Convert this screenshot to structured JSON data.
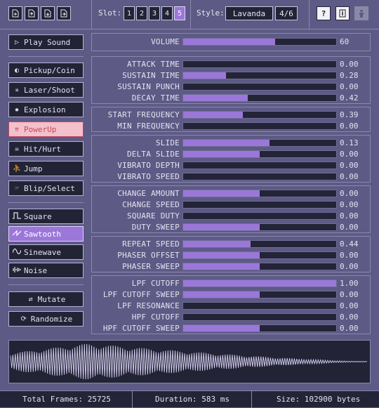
{
  "toolbar": {
    "slot_label": "Slot:",
    "slots": [
      "1",
      "2",
      "3",
      "4",
      "5"
    ],
    "active_slot": "5",
    "style_label": "Style:",
    "style_value": "Lavanda",
    "style_counter": "4/6"
  },
  "generators": [
    {
      "label": "Play Sound",
      "icon": "play-icon"
    },
    {
      "label": "Pickup/Coin",
      "icon": "coin-icon"
    },
    {
      "label": "Laser/Shoot",
      "icon": "laser-icon"
    },
    {
      "label": "Explosion",
      "icon": "explosion-icon"
    },
    {
      "label": "PowerUp",
      "icon": "powerup-icon"
    },
    {
      "label": "Hit/Hurt",
      "icon": "skull-icon"
    },
    {
      "label": "Jump",
      "icon": "jump-icon"
    },
    {
      "label": "Blip/Select",
      "icon": "blip-icon"
    }
  ],
  "waveforms": [
    {
      "label": "Square",
      "icon": "square-wave-icon"
    },
    {
      "label": "Sawtooth",
      "icon": "sawtooth-wave-icon"
    },
    {
      "label": "Sinewave",
      "icon": "sine-wave-icon"
    },
    {
      "label": "Noise",
      "icon": "noise-wave-icon"
    }
  ],
  "actions": [
    {
      "label": "Mutate",
      "icon": "mutate-icon"
    },
    {
      "label": "Randomize",
      "icon": "randomize-icon"
    }
  ],
  "volume": {
    "label": "VOLUME",
    "value": "60",
    "fraction": 0.6
  },
  "params": [
    {
      "label": "ATTACK TIME",
      "value": "0.00",
      "fraction": 0.0
    },
    {
      "label": "SUSTAIN TIME",
      "value": "0.28",
      "fraction": 0.28
    },
    {
      "label": "SUSTAIN PUNCH",
      "value": "0.00",
      "fraction": 0.0
    },
    {
      "label": "DECAY TIME",
      "value": "0.42",
      "fraction": 0.42
    },
    {
      "label": "START FREQUENCY",
      "value": "0.39",
      "fraction": 0.39
    },
    {
      "label": "MIN FREQUENCY",
      "value": "0.00",
      "fraction": 0.0
    },
    {
      "label": "SLIDE",
      "value": "0.13",
      "fraction": 0.565
    },
    {
      "label": "DELTA SLIDE",
      "value": "0.00",
      "fraction": 0.5
    },
    {
      "label": "VIBRATO DEPTH",
      "value": "0.00",
      "fraction": 0.0
    },
    {
      "label": "VIBRATO SPEED",
      "value": "0.00",
      "fraction": 0.0
    },
    {
      "label": "CHANGE AMOUNT",
      "value": "0.00",
      "fraction": 0.5
    },
    {
      "label": "CHANGE SPEED",
      "value": "0.00",
      "fraction": 0.0
    },
    {
      "label": "SQUARE DUTY",
      "value": "0.00",
      "fraction": 0.0
    },
    {
      "label": "DUTY SWEEP",
      "value": "0.00",
      "fraction": 0.5
    },
    {
      "label": "REPEAT SPEED",
      "value": "0.44",
      "fraction": 0.44
    },
    {
      "label": "PHASER OFFSET",
      "value": "0.00",
      "fraction": 0.5
    },
    {
      "label": "PHASER SWEEP",
      "value": "0.00",
      "fraction": 0.5
    },
    {
      "label": "LPF CUTOFF",
      "value": "1.00",
      "fraction": 1.0
    },
    {
      "label": "LPF CUTOFF SWEEP",
      "value": "0.00",
      "fraction": 0.5
    },
    {
      "label": "LPF RESONANCE",
      "value": "0.00",
      "fraction": 0.0
    },
    {
      "label": "HPF CUTOFF",
      "value": "0.00",
      "fraction": 0.0
    },
    {
      "label": "HPF CUTOFF SWEEP",
      "value": "0.00",
      "fraction": 0.5
    }
  ],
  "status": {
    "frames": "Total Frames: 25725",
    "duration": "Duration: 583 ms",
    "size": "Size: 102900 bytes"
  },
  "colors": {
    "background": "#5d5a85",
    "panel": "#222436",
    "accent": "#9b77d9",
    "selected_red_bg": "#f3c1cb",
    "selected_red_text": "#c4465c",
    "wave": "#d9d1f2"
  }
}
